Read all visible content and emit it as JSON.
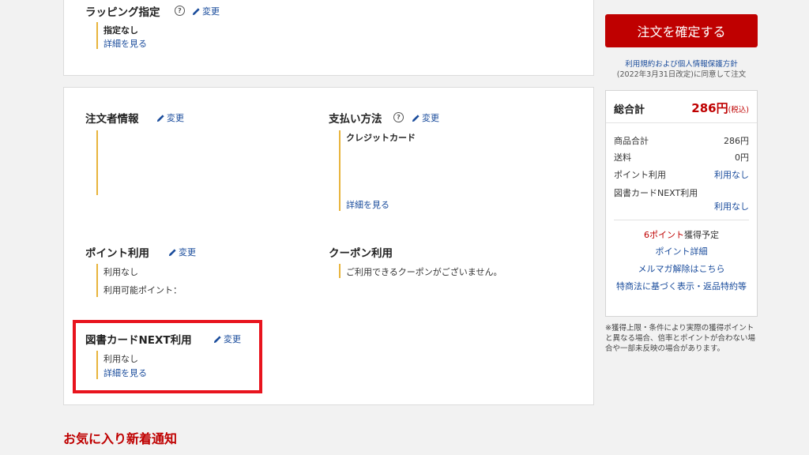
{
  "wrapping": {
    "heading": "ラッピング指定",
    "edit_label": "変更",
    "value": "指定なし",
    "details_link": "詳細を見る"
  },
  "orderer": {
    "heading": "注文者情報",
    "edit_label": "変更"
  },
  "payment": {
    "heading": "支払い方法",
    "edit_label": "変更",
    "value": "クレジットカード",
    "details_link": "詳細を見る"
  },
  "points": {
    "heading": "ポイント利用",
    "edit_label": "変更",
    "value": "利用なし",
    "available_label": "利用可能ポイント："
  },
  "coupon": {
    "heading": "クーポン利用",
    "value": "ご利用できるクーポンがございません。"
  },
  "tosho_card": {
    "heading": "図書カードNEXT利用",
    "edit_label": "変更",
    "value": "利用なし",
    "details_link": "詳細を見る"
  },
  "sidebar": {
    "confirm_button": "注文を確定する",
    "terms_link": "利用規約および個人情報保護方針",
    "terms_note": "(2022年3月31日改定)に同意して注文",
    "total_label": "総合計",
    "total_value": "286円",
    "tax_note": "(税込)",
    "rows": [
      {
        "label": "商品合計",
        "value": "286円"
      },
      {
        "label": "送料",
        "value": "0円"
      },
      {
        "label": "ポイント利用",
        "value": "利用なし"
      }
    ],
    "tosho_label": "図書カードNEXT利用",
    "tosho_value": "利用なし",
    "earn_points": "6ポイント",
    "earn_suffix": "獲得予定",
    "point_details": "ポイント詳細",
    "mailmag": "メルマガ解除はこちら",
    "tokusho": "特商法に基づく表示・返品特約等",
    "note": "※獲得上限・条件により実際の獲得ポイントと異なる場合、倍率とポイントが合わない場合や一部未反映の場合があります。"
  },
  "favorites_title": "お気に入り新着通知",
  "colors": {
    "accent_red": "#bf0000",
    "link_blue": "#1a4c9c",
    "bar_yellow": "#e8b43c",
    "highlight_red": "#e8141e"
  }
}
